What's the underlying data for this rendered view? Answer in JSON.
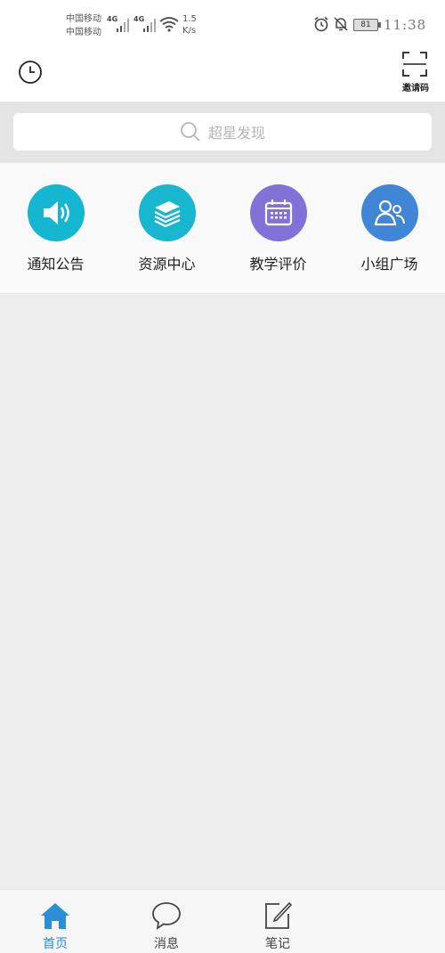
{
  "status_bar": {
    "carrier_1": "中国移动",
    "carrier_2": "中国移动",
    "signal_1": "4G",
    "signal_2": "4G",
    "speed_value": "1.5",
    "speed_unit": "K/s",
    "battery": "81",
    "time": "11:38"
  },
  "header": {
    "history_icon": "clock-icon",
    "invite_label": "邀请码"
  },
  "search": {
    "placeholder": "超星发现"
  },
  "grid": {
    "items": [
      {
        "label": "通知公告",
        "icon": "speaker-icon",
        "color": "#15b6d0"
      },
      {
        "label": "资源中心",
        "icon": "books-icon",
        "color": "#18b7cf"
      },
      {
        "label": "教学评价",
        "icon": "calendar-icon",
        "color": "#8272d8"
      },
      {
        "label": "小组广场",
        "icon": "group-icon",
        "color": "#3f86d6"
      }
    ]
  },
  "tabs": [
    {
      "label": "首页",
      "icon": "home-icon",
      "active": true
    },
    {
      "label": "消息",
      "icon": "chat-bubble-icon",
      "active": false
    },
    {
      "label": "笔记",
      "icon": "edit-note-icon",
      "active": false
    }
  ],
  "colors": {
    "accent": "#2a8fd4",
    "background": "#eeeeee"
  }
}
